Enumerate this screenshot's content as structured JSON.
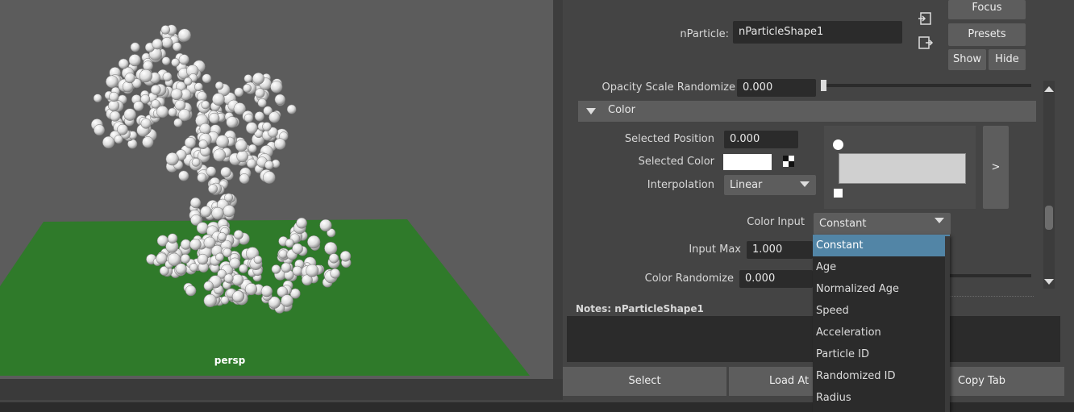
{
  "viewport": {
    "camera": "persp"
  },
  "attribute_editor": {
    "node_label": "nParticle:",
    "node_value": "nParticleShape1",
    "focus_label": "Focus",
    "presets_label": "Presets",
    "show_label": "Show",
    "hide_label": "Hide",
    "opacity_scale_randomize": {
      "label": "Opacity Scale Randomize",
      "value": "0.000",
      "slider_fraction": 0.0
    },
    "color_section": "Color",
    "selected_position": {
      "label": "Selected Position",
      "value": "0.000"
    },
    "selected_color": {
      "label": "Selected Color"
    },
    "interpolation": {
      "label": "Interpolation",
      "value": "Linear"
    },
    "ramp_expand_label": ">",
    "color_input": {
      "label": "Color Input",
      "value": "Constant"
    },
    "input_max": {
      "label": "Input Max",
      "value": "1.000"
    },
    "color_randomize": {
      "label": "Color Randomize",
      "value": "0.000"
    },
    "notes_label": "Notes:  nParticleShape1",
    "buttons": {
      "select": "Select",
      "load_attributes": "Load At",
      "copy_tab": "Copy Tab"
    }
  },
  "dropdown": {
    "options": [
      "Constant",
      "Age",
      "Normalized Age",
      "Speed",
      "Acceleration",
      "Particle ID",
      "Randomized ID",
      "Radius"
    ],
    "selected_index": 0
  },
  "colors": {
    "ground": "#2f7a2a",
    "viewport_bg": "#5c5c5c",
    "selection": "#5285a6"
  }
}
